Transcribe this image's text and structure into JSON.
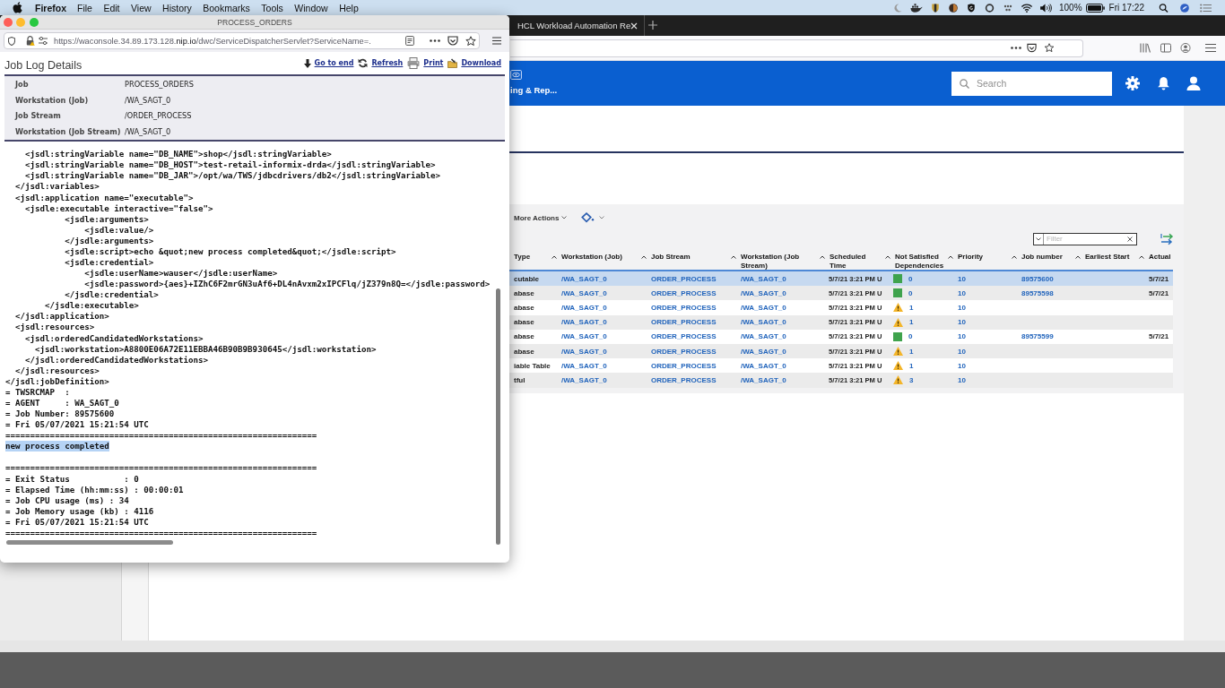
{
  "menu_bar": {
    "app_name": "Firefox",
    "menus": [
      "File",
      "Edit",
      "View",
      "History",
      "Bookmarks",
      "Tools",
      "Window",
      "Help"
    ],
    "battery": "100%",
    "clock": "Fri 17:22"
  },
  "browser": {
    "tab": {
      "title": "HCL Workload Automation Re"
    },
    "header": {
      "nav_label": "ing & Rep...",
      "search": {
        "placeholder": "Search"
      }
    },
    "jobs_panel": {
      "more_actions": "More Actions",
      "filter": {
        "placeholder": "Filter"
      },
      "table": {
        "columns": [
          {
            "label": "Type",
            "sort_indicator": false
          },
          {
            "label": "Workstation (Job)",
            "sort_indicator": true
          },
          {
            "label": "Job Stream",
            "sort_indicator": true
          },
          {
            "label": "Workstation (Job Stream)",
            "sort_indicator": true
          },
          {
            "label": "Scheduled Time",
            "sort_indicator": true
          },
          {
            "label": "Not Satisfied Dependencies",
            "sort_indicator": true
          },
          {
            "label": "Priority",
            "sort_indicator": true
          },
          {
            "label": "Job number",
            "sort_indicator": true
          },
          {
            "label": "Earliest Start",
            "sort_indicator": true
          },
          {
            "label": "Actual",
            "sort_indicator": true
          }
        ],
        "rows": [
          {
            "selected": true,
            "type": "cutable",
            "workstation_job": "/WA_SAGT_0",
            "job_stream": "ORDER_PROCESS",
            "workstation_job_stream": "/WA_SAGT_0",
            "scheduled_time": "5/7/21 3:21 PM U",
            "dependencies_satisfied": true,
            "not_satisfied_dependencies": "0",
            "priority": "10",
            "job_number": "89575600",
            "actual": "5/7/21"
          },
          {
            "selected": false,
            "type": "abase",
            "workstation_job": "/WA_SAGT_0",
            "job_stream": "ORDER_PROCESS",
            "workstation_job_stream": "/WA_SAGT_0",
            "scheduled_time": "5/7/21 3:21 PM U",
            "dependencies_satisfied": true,
            "not_satisfied_dependencies": "0",
            "priority": "10",
            "job_number": "89575598",
            "actual": "5/7/21"
          },
          {
            "selected": false,
            "type": "abase",
            "workstation_job": "/WA_SAGT_0",
            "job_stream": "ORDER_PROCESS",
            "workstation_job_stream": "/WA_SAGT_0",
            "scheduled_time": "5/7/21 3:21 PM U",
            "dependencies_satisfied": false,
            "not_satisfied_dependencies": "1",
            "priority": "10"
          },
          {
            "selected": false,
            "type": "abase",
            "workstation_job": "/WA_SAGT_0",
            "job_stream": "ORDER_PROCESS",
            "workstation_job_stream": "/WA_SAGT_0",
            "scheduled_time": "5/7/21 3:21 PM U",
            "dependencies_satisfied": false,
            "not_satisfied_dependencies": "1",
            "priority": "10"
          },
          {
            "selected": false,
            "type": "abase",
            "workstation_job": "/WA_SAGT_0",
            "job_stream": "ORDER_PROCESS",
            "workstation_job_stream": "/WA_SAGT_0",
            "scheduled_time": "5/7/21 3:21 PM U",
            "dependencies_satisfied": true,
            "not_satisfied_dependencies": "0",
            "priority": "10",
            "job_number": "89575599",
            "actual": "5/7/21"
          },
          {
            "selected": false,
            "type": "abase",
            "workstation_job": "/WA_SAGT_0",
            "job_stream": "ORDER_PROCESS",
            "workstation_job_stream": "/WA_SAGT_0",
            "scheduled_time": "5/7/21 3:21 PM U",
            "dependencies_satisfied": false,
            "not_satisfied_dependencies": "1",
            "priority": "10"
          },
          {
            "selected": false,
            "type": "iable Table",
            "workstation_job": "/WA_SAGT_0",
            "job_stream": "ORDER_PROCESS",
            "workstation_job_stream": "/WA_SAGT_0",
            "scheduled_time": "5/7/21 3:21 PM U",
            "dependencies_satisfied": false,
            "not_satisfied_dependencies": "1",
            "priority": "10"
          },
          {
            "selected": false,
            "type": "tful",
            "workstation_job": "/WA_SAGT_0",
            "job_stream": "ORDER_PROCESS",
            "workstation_job_stream": "/WA_SAGT_0",
            "scheduled_time": "5/7/21 3:21 PM U",
            "dependencies_satisfied": false,
            "not_satisfied_dependencies": "3",
            "priority": "10"
          }
        ]
      }
    }
  },
  "popup": {
    "title": "PROCESS_ORDERS",
    "url": {
      "prefix": "https://waconsole.34.89.173.128.",
      "base_domain": "nip.io",
      "path": "/dwc/ServiceDispatcherServlet?ServiceName=."
    },
    "heading": "Job Log Details",
    "actions": [
      {
        "kind": "jump",
        "label": "Go to end"
      },
      {
        "kind": "refresh",
        "label": "Refresh"
      },
      {
        "kind": "print",
        "label": "Print"
      },
      {
        "kind": "download",
        "label": "Download"
      }
    ],
    "details": [
      {
        "label": "Job",
        "value": "PROCESS_ORDERS"
      },
      {
        "label": "Workstation (Job)",
        "value": "/WA_SAGT_0"
      },
      {
        "label": "Job Stream",
        "value": "/ORDER_PROCESS"
      },
      {
        "label": "Workstation (Job Stream)",
        "value": "/WA_SAGT_0"
      }
    ],
    "log": {
      "lines": [
        {
          "kind": "code",
          "text": "    <jsdl:stringVariable name=\"DB_NAME\">shop</jsdl:stringVariable>",
          "highlighted": false
        },
        {
          "kind": "code",
          "text": "    <jsdl:stringVariable name=\"DB_HOST\">test-retail-informix-drda</jsdl:stringVariable>",
          "highlighted": false
        },
        {
          "kind": "code",
          "text": "    <jsdl:stringVariable name=\"DB_JAR\">/opt/wa/TWS/jdbcdrivers/db2</jsdl:stringVariable>",
          "highlighted": false
        },
        {
          "kind": "code",
          "text": "  </jsdl:variables>",
          "highlighted": false
        },
        {
          "kind": "code",
          "text": "  <jsdl:application name=\"executable\">",
          "highlighted": false
        },
        {
          "kind": "code",
          "text": "    <jsdle:executable interactive=\"false\">",
          "highlighted": false
        },
        {
          "kind": "code",
          "text": "            <jsdle:arguments>",
          "highlighted": false
        },
        {
          "kind": "code",
          "text": "                <jsdle:value/>",
          "highlighted": false
        },
        {
          "kind": "code",
          "text": "            </jsdle:arguments>",
          "highlighted": false
        },
        {
          "kind": "code",
          "text": "            <jsdle:script>echo &quot;new process completed&quot;</jsdle:script>",
          "highlighted": false
        },
        {
          "kind": "code",
          "text": "            <jsdle:credential>",
          "highlighted": false
        },
        {
          "kind": "code",
          "text": "                <jsdle:userName>wauser</jsdle:userName>",
          "highlighted": false
        },
        {
          "kind": "code",
          "text": "                <jsdle:password>{aes}+IZhC6F2mrGN3uAf6+DL4nAvxm2xIPCFlq/jZ379n8Q=</jsdle:password>",
          "highlighted": false
        },
        {
          "kind": "code",
          "text": "            </jsdle:credential>",
          "highlighted": false
        },
        {
          "kind": "code",
          "text": "        </jsdle:executable>",
          "highlighted": false
        },
        {
          "kind": "code",
          "text": "  </jsdl:application>",
          "highlighted": false
        },
        {
          "kind": "code",
          "text": "  <jsdl:resources>",
          "highlighted": false
        },
        {
          "kind": "code",
          "text": "    <jsdl:orderedCandidatedWorkstations>",
          "highlighted": false
        },
        {
          "kind": "code",
          "text": "      <jsdl:workstation>A8800E06A72E11EBBA46B90B9B930645</jsdl:workstation>",
          "highlighted": false
        },
        {
          "kind": "code",
          "text": "    </jsdl:orderedCandidatedWorkstations>",
          "highlighted": false
        },
        {
          "kind": "code",
          "text": "  </jsdl:resources>",
          "highlighted": false
        },
        {
          "kind": "code",
          "text": "</jsdl:jobDefinition>",
          "highlighted": false
        },
        {
          "kind": "code",
          "text": "= TWSRCMAP  :",
          "highlighted": false
        },
        {
          "kind": "code",
          "text": "= AGENT     : WA_SAGT_0",
          "highlighted": false
        },
        {
          "kind": "code",
          "text": "= Job Number: 89575600",
          "highlighted": false
        },
        {
          "kind": "code",
          "text": "= Fri 05/07/2021 15:21:54 UTC",
          "highlighted": false
        },
        {
          "kind": "code",
          "text": "===============================================================",
          "highlighted": false
        },
        {
          "kind": "code",
          "text": "new process completed",
          "highlighted": true
        },
        {
          "kind": "blank"
        },
        {
          "kind": "code",
          "text": "===============================================================",
          "highlighted": false
        },
        {
          "kind": "code",
          "text": "= Exit Status           : 0",
          "highlighted": false
        },
        {
          "kind": "code",
          "text": "= Elapsed Time (hh:mm:ss) : 00:00:01",
          "highlighted": false
        },
        {
          "kind": "code",
          "text": "= Job CPU usage (ms) : 34",
          "highlighted": false
        },
        {
          "kind": "code",
          "text": "= Job Memory usage (kb) : 4116",
          "highlighted": false
        },
        {
          "kind": "code",
          "text": "= Fri 05/07/2021 15:21:54 UTC",
          "highlighted": false
        },
        {
          "kind": "code",
          "text": "===============================================================",
          "highlighted": false
        }
      ]
    }
  }
}
